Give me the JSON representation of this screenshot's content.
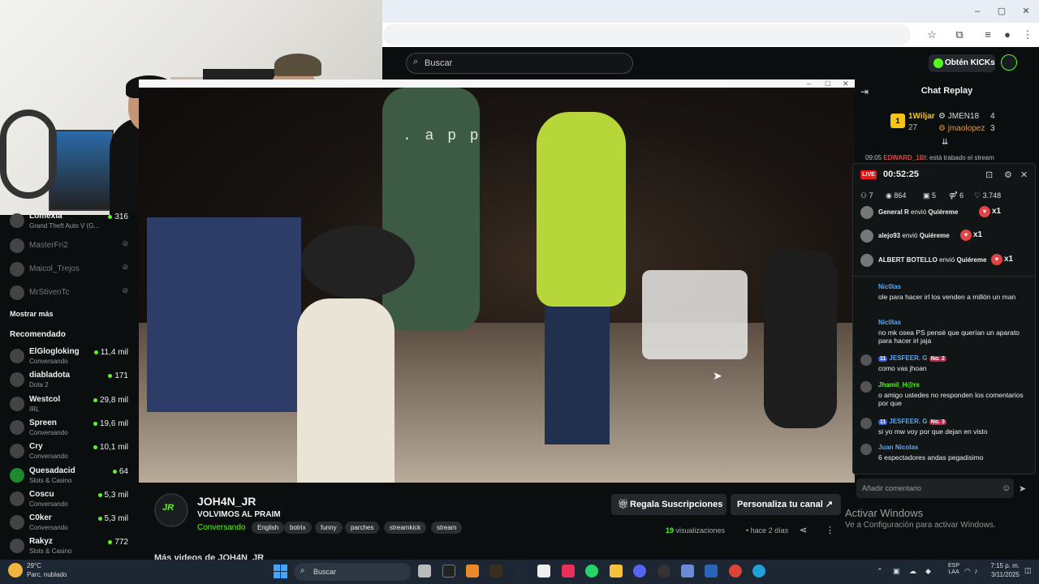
{
  "browser": {
    "window_controls": [
      "–",
      "▢",
      "✕"
    ],
    "toolbar_icons": [
      "star-icon",
      "extensions-icon",
      "media-icon",
      "profile-icon",
      "menu-icon"
    ]
  },
  "header": {
    "search_placeholder": "Buscar",
    "kicks_button": "Obtén KICKs"
  },
  "sidebar": {
    "followed": [
      {
        "name": "Lomexia",
        "sub": "Grand Theft Auto V (G...",
        "count": "316",
        "live": true
      },
      {
        "name": "MasterFri2",
        "live": false
      },
      {
        "name": "Maicol_Trejos",
        "live": false
      },
      {
        "name": "MrStivenTc",
        "live": false
      }
    ],
    "show_more": "Mostrar más",
    "recommended_title": "Recomendado",
    "recommended": [
      {
        "name": "ElGlogloking",
        "sub": "Conversando",
        "count": "11,4 mil"
      },
      {
        "name": "diabladota",
        "sub": "Dota 2",
        "count": "171"
      },
      {
        "name": "Westcol",
        "sub": "IRL",
        "count": "29,8 mil"
      },
      {
        "name": "Spreen",
        "sub": "Conversando",
        "count": "19,6 mil"
      },
      {
        "name": "Cry",
        "sub": "Conversando",
        "count": "10,1 mil"
      },
      {
        "name": "Quesadacid",
        "sub": "Slots & Casino",
        "count": "64"
      },
      {
        "name": "Coscu",
        "sub": "Conversando",
        "count": "5,3 mil"
      },
      {
        "name": "C0ker",
        "sub": "Conversando",
        "count": "5,3 mil"
      },
      {
        "name": "Rakyz",
        "sub": "Slots & Casino",
        "count": "772"
      }
    ]
  },
  "video": {
    "overlay_text": ". a p p"
  },
  "channel": {
    "logo": "JR",
    "name": "JOH4N_JR",
    "title": "VOLVIMOS AL PRAIM",
    "category": "Conversando",
    "tags": [
      "English",
      "botrix",
      "funny",
      "parches",
      "streamkick",
      "stream"
    ],
    "gift_subs_button": "Regala Suscripciones",
    "customize_button": "Personaliza tu canal",
    "views_count": "19",
    "views_label": "visualizaciones",
    "ago": "hace 2 días",
    "more_videos": "Más videos de JOH4N_JR"
  },
  "chat": {
    "title": "Chat Replay",
    "leaderboard": [
      {
        "name": "1Wiljar",
        "value": "27"
      },
      {
        "name": "JMEN18",
        "value": "4"
      },
      {
        "name": "jmaolopez",
        "value": "3"
      }
    ],
    "ticker_time": "09:05",
    "ticker_user": "EDWARD_1BI",
    "ticker_text": ": está trabado el stream",
    "overlay": {
      "live_label": "LIVE",
      "time": "00:52:25",
      "stats": [
        "7",
        "864",
        "5",
        "6",
        "3.748"
      ],
      "gifts": [
        {
          "user": "General R",
          "verb": "envió",
          "item": "Quiéreme",
          "mult": "x1"
        },
        {
          "user": "alejo93",
          "verb": "envió",
          "item": "Quiéreme",
          "mult": "x1"
        },
        {
          "user": "ALBERT BOTELLO",
          "verb": "envió",
          "item": "Quiéreme",
          "mult": "x1"
        }
      ],
      "messages": [
        {
          "user": "Nic0las",
          "badge": "",
          "text": "ole para hacer irl los venden a millón un man"
        },
        {
          "user": "Nic0las",
          "badge": "",
          "text": "no mk osea PS pensé que querían un aparato para hacer irl jaja"
        },
        {
          "user": "JESFEER. G",
          "badge": "No. 2",
          "sub": "11",
          "text": "como vas jhoan"
        },
        {
          "user": "Jhamil_H@rs",
          "badge": "",
          "text": "o amigo ustedes no responden los comentarios por que"
        },
        {
          "user": "JESFEER. G",
          "badge": "No. 3",
          "sub": "11",
          "text": "si yo mw voy por que dejan en visto"
        },
        {
          "user": "Juan Nicolas",
          "badge": "",
          "text": "6 espectadores andas pegadisimo"
        }
      ]
    },
    "comment_placeholder": "Añadir comentario"
  },
  "windows": {
    "activate_title": "Activar Windows",
    "activate_sub": "Ve a Configuración para activar Windows.",
    "weather_temp": "29°C",
    "weather_desc": "Parc. nublado",
    "search": "Buscar",
    "lang": "ESP",
    "lang2": "LAA",
    "time": "7:15 p. m.",
    "date": "3/11/2025"
  },
  "colors": {
    "kick_green": "#53fc18",
    "background": "#0b0e0f",
    "live_red": "#e91916"
  }
}
